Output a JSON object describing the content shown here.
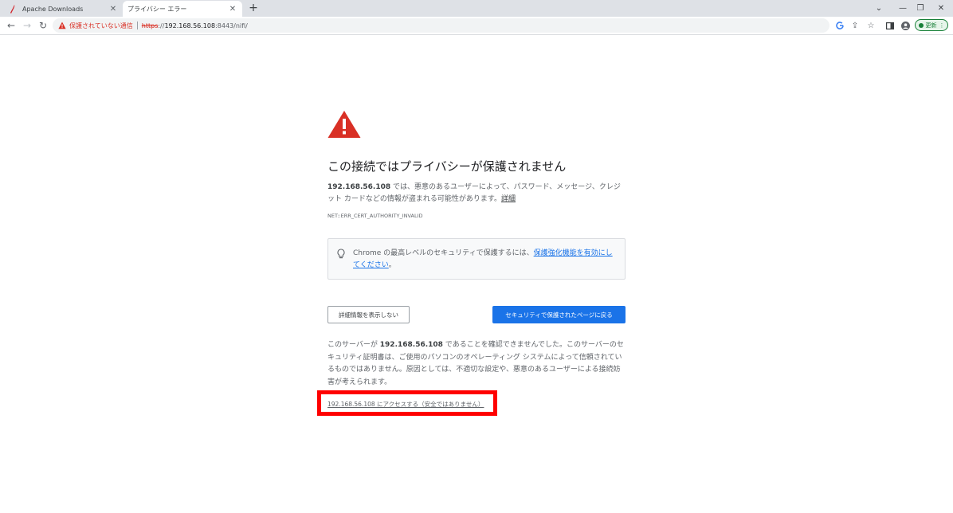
{
  "tabs": [
    {
      "title": "Apache Downloads",
      "favicon": "apache-feather-icon",
      "active": false
    },
    {
      "title": "プライバシー エラー",
      "favicon": "none",
      "active": true
    }
  ],
  "toolbar": {
    "security_label": "保護されていない通信",
    "url_scheme": "https",
    "url_separator": "://",
    "url_host": "192.168.56.108",
    "url_path": ":8443/nifi/",
    "update_label": "更新"
  },
  "page": {
    "heading": "この接続ではプライバシーが保護されません",
    "explanation_host": "192.168.56.108",
    "explanation_text": " では、悪意のあるユーザーによって、パスワード、メッセージ、クレジット カードなどの情報が盗まれる可能性があります。",
    "explanation_link": "詳細",
    "error_code": "NET::ERR_CERT_AUTHORITY_INVALID",
    "enhanced_text": "Chrome の最高レベルのセキュリティで保護するには、",
    "enhanced_link": "保護強化機能を有効にしてください",
    "enhanced_suffix": "。",
    "details_button": "詳細情報を表示しない",
    "back_button": "セキュリティで保護されたページに戻る",
    "details_prefix": "このサーバーが ",
    "details_host": "192.168.56.108",
    "details_text": " であることを確認できませんでした。このサーバーのセキュリティ証明書は、ご使用のパソコンのオペレーティング システムによって信頼されているものではありません。原因としては、不適切な設定や、悪意のあるユーザーによる接続妨害が考えられます。",
    "proceed_link": "192.168.56.108 にアクセスする（安全ではありません）"
  },
  "colors": {
    "warning_red": "#d93025",
    "primary_blue": "#1a73e8",
    "highlight_red": "#ff0000",
    "update_green": "#188038"
  }
}
